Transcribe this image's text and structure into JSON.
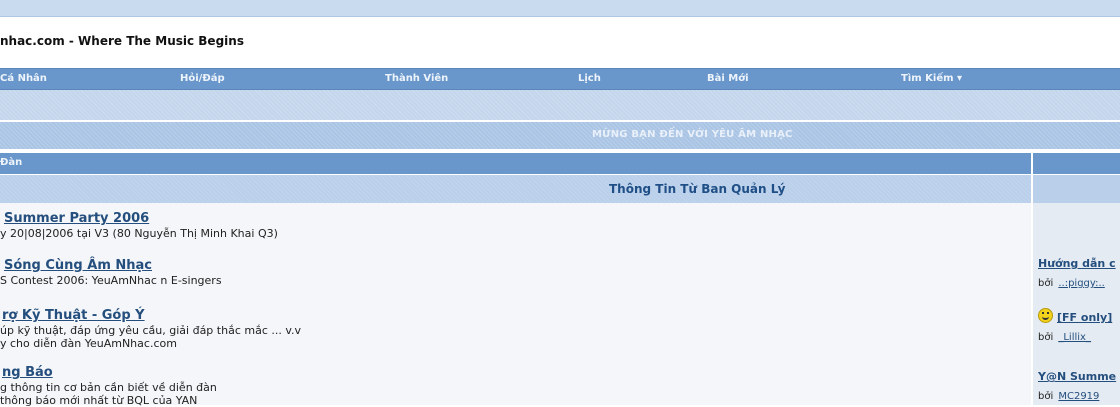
{
  "site": {
    "title": "nhac.com - Where The Music Begins"
  },
  "nav": {
    "items": [
      {
        "label": "Cá Nhân"
      },
      {
        "label": "Hỏi/Đáp"
      },
      {
        "label": "Thành Viên"
      },
      {
        "label": "Lịch"
      },
      {
        "label": "Bài Mới"
      },
      {
        "label": "Tìm Kiếm ▾"
      }
    ]
  },
  "welcome": {
    "text": "MỪNG BẠN ĐẾN VỚI YÊU ÂM NHẠC"
  },
  "forum_header": {
    "label": "Đàn"
  },
  "category": {
    "title": "Thông Tin Từ Ban Quản Lý"
  },
  "forums": [
    {
      "title": "Summer Party 2006",
      "desc": [
        "y 20|08|2006 tại V3 (80 Nguyễn Thị Minh Khai Q3)"
      ]
    },
    {
      "title": "Sóng Cùng Âm Nhạc",
      "desc": [
        "S Contest 2006: YeuAmNhac n E-singers"
      ]
    },
    {
      "title": "rợ Kỹ Thuật - Góp Ý",
      "desc": [
        "úp kỹ thuật, đáp ứng yêu cầu, giải đáp thắc mắc ... v.v",
        "y cho diễn đàn YeuAmNhac.com"
      ]
    },
    {
      "title": "ng Báo",
      "desc": [
        "g thông tin cơ bản cần biết về diễn đàn",
        "thông báo mới nhất từ BQL của YAN"
      ]
    }
  ],
  "last_posts": [
    {
      "title": "Hướng dẫn c",
      "by": "bởi",
      "user": "..:piggy:.."
    },
    {
      "title": "[FF only]",
      "by": "bởi",
      "user": "_Lillix_"
    },
    {
      "title": "Y@N Summe",
      "by": "bởi",
      "user": "MC2919"
    }
  ]
}
